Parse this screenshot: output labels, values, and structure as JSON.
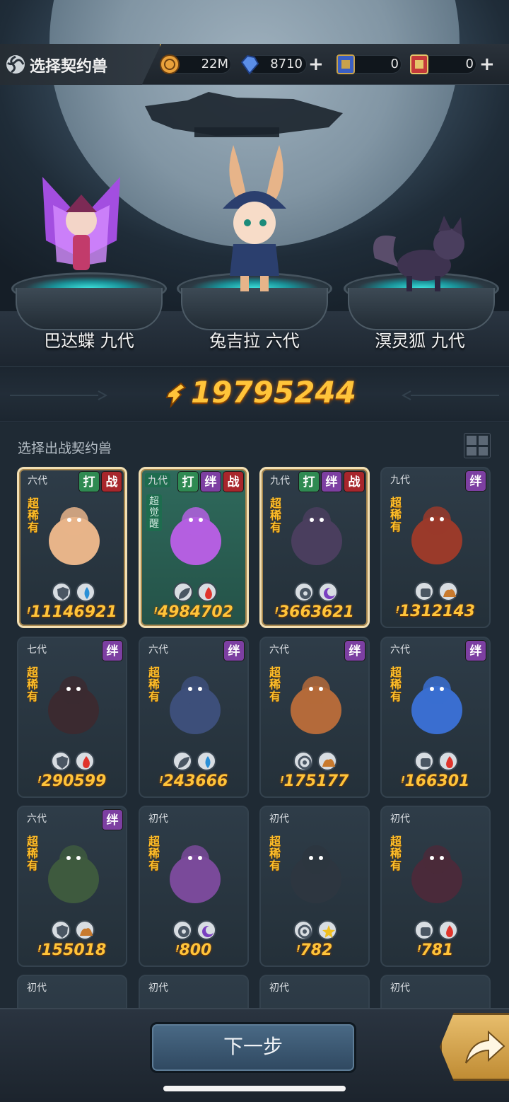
{
  "header": {
    "title": "选择契约兽",
    "resources": [
      {
        "name": "gold-coin",
        "value": "22M",
        "has_plus": false
      },
      {
        "name": "blue-crystal",
        "value": "8710",
        "has_plus": true
      },
      {
        "name": "blue-ticket",
        "value": "0",
        "has_plus": false
      },
      {
        "name": "gold-ticket",
        "value": "0",
        "has_plus": true
      }
    ]
  },
  "team": [
    {
      "name": "巴达蝶 九代"
    },
    {
      "name": "兔吉拉 六代"
    },
    {
      "name": "溟灵狐 九代"
    }
  ],
  "total_power": "19795244",
  "list": {
    "title": "选择出战契约兽",
    "cards": [
      {
        "gen": "六代",
        "tags": [
          "打",
          "战"
        ],
        "rarity": "超稀有",
        "attrs": [
          "shield-icon",
          "water-icon"
        ],
        "power": "11146921",
        "selected": true
      },
      {
        "gen": "九代",
        "tags": [
          "打",
          "绊",
          "战"
        ],
        "rarity": "超觉醒",
        "attrs": [
          "leaf-icon",
          "fire-icon"
        ],
        "power": "4984702",
        "selected": true,
        "awakened": true
      },
      {
        "gen": "九代",
        "tags": [
          "打",
          "绊",
          "战"
        ],
        "rarity": "超稀有",
        "attrs": [
          "eye-icon",
          "moon-icon"
        ],
        "power": "3663621",
        "selected": true
      },
      {
        "gen": "九代",
        "tags": [
          "绊"
        ],
        "rarity": "超稀有",
        "attrs": [
          "fist-icon",
          "earth-icon"
        ],
        "power": "1312143"
      },
      {
        "gen": "七代",
        "tags": [
          "绊"
        ],
        "rarity": "超稀有",
        "attrs": [
          "shield-icon",
          "fire-icon"
        ],
        "power": "290599"
      },
      {
        "gen": "六代",
        "tags": [
          "绊"
        ],
        "rarity": "超稀有",
        "attrs": [
          "leaf-icon",
          "water-icon"
        ],
        "power": "243666"
      },
      {
        "gen": "六代",
        "tags": [
          "绊"
        ],
        "rarity": "超稀有",
        "attrs": [
          "target-icon",
          "earth-icon"
        ],
        "power": "175177"
      },
      {
        "gen": "六代",
        "tags": [
          "绊"
        ],
        "rarity": "超稀有",
        "attrs": [
          "fist-icon",
          "fire-icon"
        ],
        "power": "166301"
      },
      {
        "gen": "六代",
        "tags": [
          "绊"
        ],
        "rarity": "超稀有",
        "attrs": [
          "shield-icon",
          "earth-icon"
        ],
        "power": "155018"
      },
      {
        "gen": "初代",
        "tags": [],
        "rarity": "超稀有",
        "attrs": [
          "eye-icon",
          "moon-icon"
        ],
        "power": "800"
      },
      {
        "gen": "初代",
        "tags": [],
        "rarity": "超稀有",
        "attrs": [
          "target-icon",
          "star-icon"
        ],
        "power": "782"
      },
      {
        "gen": "初代",
        "tags": [],
        "rarity": "超稀有",
        "attrs": [
          "fist-icon",
          "fire-icon"
        ],
        "power": "781"
      },
      {
        "gen": "初代"
      },
      {
        "gen": "初代"
      },
      {
        "gen": "初代"
      },
      {
        "gen": "初代"
      }
    ]
  },
  "footer": {
    "next_label": "下一步"
  },
  "colors": {
    "gold": "#ffc43a",
    "tag_da": "#2f8a52",
    "tag_ban": "#7d3fa2",
    "tag_zhan": "#a8262c"
  }
}
